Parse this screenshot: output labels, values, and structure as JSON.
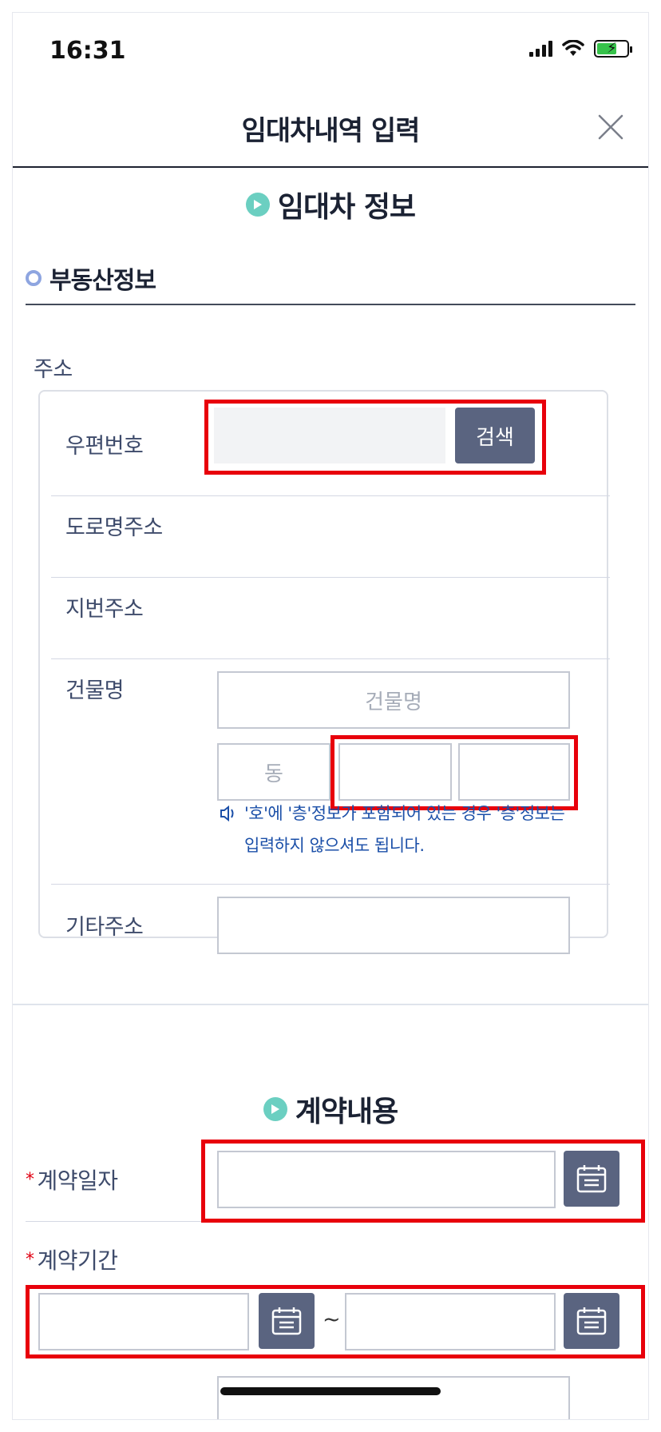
{
  "status_bar": {
    "time": "16:31"
  },
  "header": {
    "title": "임대차내역 입력"
  },
  "section_lease_info": {
    "title": "임대차 정보"
  },
  "property": {
    "subtitle": "부동산정보",
    "address_label": "주소",
    "postal_code_label": "우편번호",
    "postal_code_value": "",
    "search_button": "검색",
    "road_address_label": "도로명주소",
    "lot_address_label": "지번주소",
    "building_name_label": "건물명",
    "building_name_placeholder": "건물명",
    "dong_placeholder": "동",
    "ho_placeholder": "",
    "floor_placeholder": "",
    "notice": "'호'에 '층'정보가 포함되어 있는 경우 '층'정보는 입력하지 않으셔도 됩니다.",
    "other_address_label": "기타주소"
  },
  "section_contract": {
    "title": "계약내용",
    "contract_date_label": "계약일자",
    "contract_period_label": "계약기간",
    "period_separator": "~"
  },
  "colors": {
    "accent_button": "#5a6480",
    "highlight_red": "#e8000b",
    "section_icon": "#6bcfc1",
    "notice_blue": "#1b4fa8"
  }
}
